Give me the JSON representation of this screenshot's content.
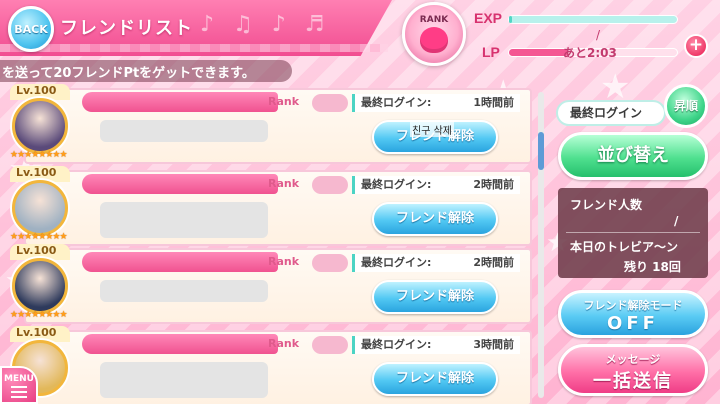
{
  "header": {
    "back_label": "BACK",
    "title": "フレンドリスト",
    "notes": "♪ ♫ ♪ ♬"
  },
  "status": {
    "rank_label": "RANK",
    "exp_label": "EXP",
    "exp_fill": 0.02,
    "exp_slash": "/",
    "lp_label": "LP",
    "lp_fill": 0.35,
    "lp_time": "あと2:03",
    "plus_label": "+"
  },
  "subtitle": "を送って20フレンドPtをゲットできます。",
  "friends": [
    {
      "level": "Lv.100",
      "rank": "Rank",
      "login_label": "最終ログイン:",
      "login_time": "1時間前",
      "button": "フレンド解除",
      "overlay": "친구 삭제",
      "stars": "★★★★★★★★",
      "avatar_color": "#5a4a7a"
    },
    {
      "level": "Lv.100",
      "rank": "Rank",
      "login_label": "最終ログイン:",
      "login_time": "2時間前",
      "button": "フレンド解除",
      "overlay": "",
      "stars": "★★★★★★★★",
      "avatar_color": "#9fb1c2"
    },
    {
      "level": "Lv.100",
      "rank": "Rank",
      "login_label": "最終ログイン:",
      "login_time": "2時間前",
      "button": "フレンド解除",
      "overlay": "",
      "stars": "★★★★★★★★",
      "avatar_color": "#2e3a5c"
    },
    {
      "level": "Lv.100",
      "rank": "Rank",
      "login_label": "最終ログイン:",
      "login_time": "3時間前",
      "button": "フレンド解除",
      "overlay": "",
      "stars": "★★★★★★★★",
      "avatar_color": "#e2b85a"
    }
  ],
  "panel": {
    "sort_label": "最終ログイン",
    "order_label": "昇順",
    "sort_button": "並び替え",
    "friend_count_label": "フレンド人数",
    "friend_count_slash": "/",
    "daily_label": "本日のトレビア〜ン",
    "remaining": "残り 18回",
    "mode_title": "フレンド解除モード",
    "mode_state": "OFF",
    "message_title": "メッセージ",
    "message_main": "一括送信"
  },
  "menu_label": "MENU",
  "colors": {
    "accent_pink": "#f14d91",
    "accent_blue": "#2aa4df",
    "accent_green": "#25c06c"
  }
}
